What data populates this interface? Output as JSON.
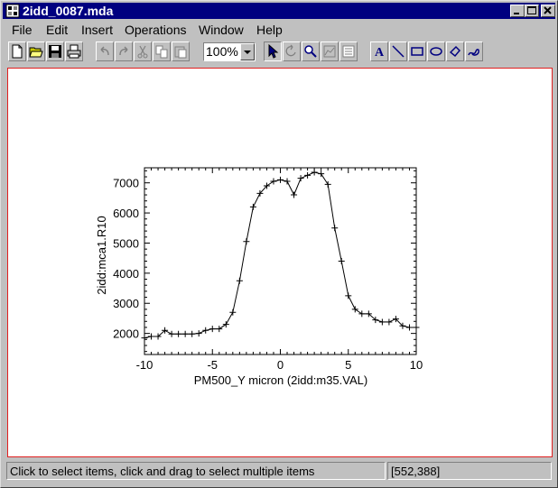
{
  "window": {
    "title": "2idd_0087.mda"
  },
  "menu": [
    "File",
    "Edit",
    "Insert",
    "Operations",
    "Window",
    "Help"
  ],
  "toolbar": {
    "zoom_value": "100%",
    "buttons": [
      "new-file-icon",
      "open-folder-icon",
      "save-icon",
      "print-icon",
      "undo-icon",
      "redo-icon",
      "cut-icon",
      "copy-icon",
      "paste-icon",
      "pointer-icon",
      "rotate-icon",
      "zoom-icon",
      "chart-icon",
      "properties-icon",
      "text-icon",
      "line-icon",
      "rectangle-icon",
      "ellipse-icon",
      "polygon-icon",
      "freehand-icon"
    ]
  },
  "chart_data": {
    "type": "line",
    "xlabel": "PM500_Y micron (2idd:m35.VAL)",
    "ylabel": "2idd:mca1.R10",
    "xlim": [
      -10,
      10
    ],
    "ylim": [
      1300,
      7500
    ],
    "xticks": [
      -10,
      -5,
      0,
      5,
      10
    ],
    "yticks": [
      2000,
      3000,
      4000,
      5000,
      6000,
      7000
    ],
    "series": [
      {
        "x": [
          -10,
          -9.5,
          -9,
          -8.5,
          -8,
          -7.5,
          -7,
          -6.5,
          -6,
          -5.5,
          -5,
          -4.5,
          -4,
          -3.5,
          -3,
          -2.5,
          -2,
          -1.5,
          -1,
          -0.5,
          0,
          0.5,
          1,
          1.5,
          2,
          2.5,
          3,
          3.5,
          4,
          4.5,
          5,
          5.5,
          6,
          6.5,
          7,
          7.5,
          8,
          8.5,
          9,
          9.5,
          10
        ],
        "y": [
          1850,
          1900,
          1900,
          2100,
          1980,
          1980,
          1980,
          1980,
          2000,
          2100,
          2150,
          2150,
          2300,
          2700,
          3750,
          5050,
          6200,
          6650,
          6900,
          7050,
          7100,
          7050,
          6600,
          7150,
          7250,
          7350,
          7300,
          6950,
          5500,
          4400,
          3250,
          2800,
          2650,
          2650,
          2450,
          2380,
          2380,
          2480,
          2250,
          2200,
          2200
        ]
      }
    ]
  }
}
